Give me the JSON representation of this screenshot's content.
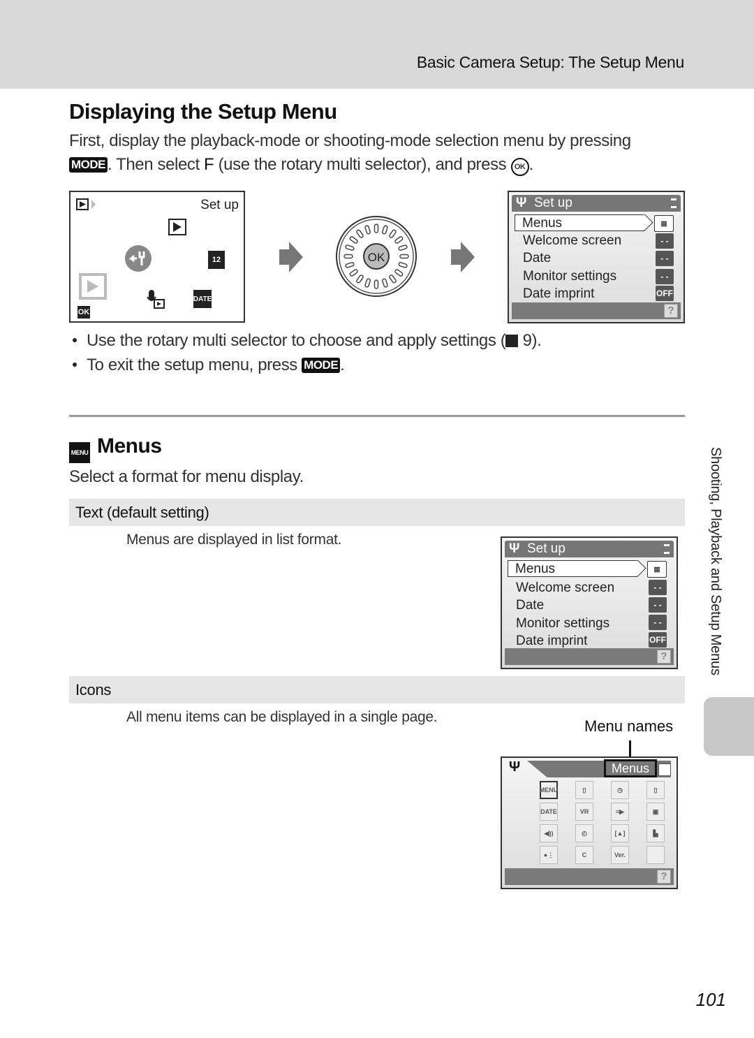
{
  "header": {
    "title": "Basic Camera Setup: The Setup Menu"
  },
  "section1": {
    "title": "Displaying the Setup Menu",
    "intro_line1": "First, display the playback-mode or shooting-mode selection menu by pressing",
    "mode_key": "MODE",
    "intro_line2_a": ". Then select ",
    "intro_line2_glyph": "F",
    "intro_line2_b": " (use the rotary multi selector), and press ",
    "ok_key": "OK",
    "intro_line2_end": "."
  },
  "mode_selection_screen": {
    "label": "Set up",
    "ok_badge": "OK",
    "icons": [
      "playback-mode-icon",
      "setup-wrench-icon",
      "calendar-icon",
      "voice-memo-playback-icon",
      "date-list-icon",
      "playback-large-icon"
    ],
    "date_icon_text": "DATE",
    "calendar_icon_text": "12"
  },
  "dial": {
    "center_label": "OK"
  },
  "setup_menu_screen": {
    "title": "Set up",
    "items": [
      {
        "label": "Menus",
        "value": "≣",
        "selected": true
      },
      {
        "label": "Welcome screen",
        "value": "- -"
      },
      {
        "label": "Date",
        "value": "- -"
      },
      {
        "label": "Monitor settings",
        "value": "- -"
      },
      {
        "label": "Date imprint",
        "value": "OFF"
      }
    ],
    "help": "?"
  },
  "bullets": [
    {
      "text_a": "Use the rotary multi selector to choose and apply settings (",
      "ref_page": " 9",
      "text_b": ")."
    },
    {
      "text_a": "To exit the setup menu, press ",
      "key": "MODE",
      "text_b": "."
    }
  ],
  "section2": {
    "icon_text": "MENU",
    "title": "Menus",
    "subtitle": "Select a format for menu display.",
    "options": [
      {
        "name": "Text (default setting)",
        "description": "Menus are displayed in list format."
      },
      {
        "name": "Icons",
        "description": "All menu items can be displayed in a single page."
      }
    ],
    "callout": "Menu names"
  },
  "icons_screen": {
    "menu_name": "Menus",
    "grid": [
      "MENU",
      "▯",
      "◷",
      "▯",
      "DATE",
      "VR",
      "≡▶",
      "▣",
      "◀))",
      "◴",
      "[▲]",
      "▙",
      "●⋮",
      "C",
      "Ver.",
      ""
    ],
    "help": "?"
  },
  "side_tab": {
    "text": "Shooting, Playback and Setup Menus"
  },
  "page_number": "101"
}
